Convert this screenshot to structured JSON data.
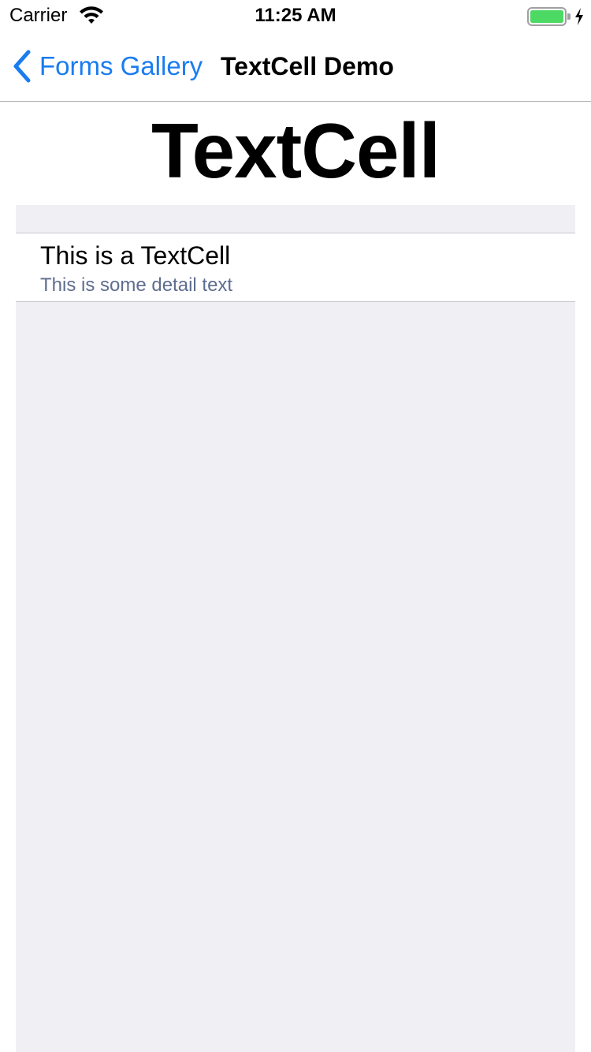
{
  "status_bar": {
    "carrier": "Carrier",
    "time": "11:25 AM",
    "wifi_icon": "wifi-icon",
    "battery_icon": "battery-full-icon",
    "charging_icon": "charging-bolt-icon",
    "battery_color": "#4cd964"
  },
  "nav": {
    "back_label": "Forms Gallery",
    "back_icon": "chevron-left-icon",
    "title": "TextCell Demo",
    "accent_color": "#1a7cf0"
  },
  "main": {
    "heading": "TextCell",
    "cells": [
      {
        "text": "This is a TextCell",
        "detail": "This is some detail text"
      }
    ]
  }
}
